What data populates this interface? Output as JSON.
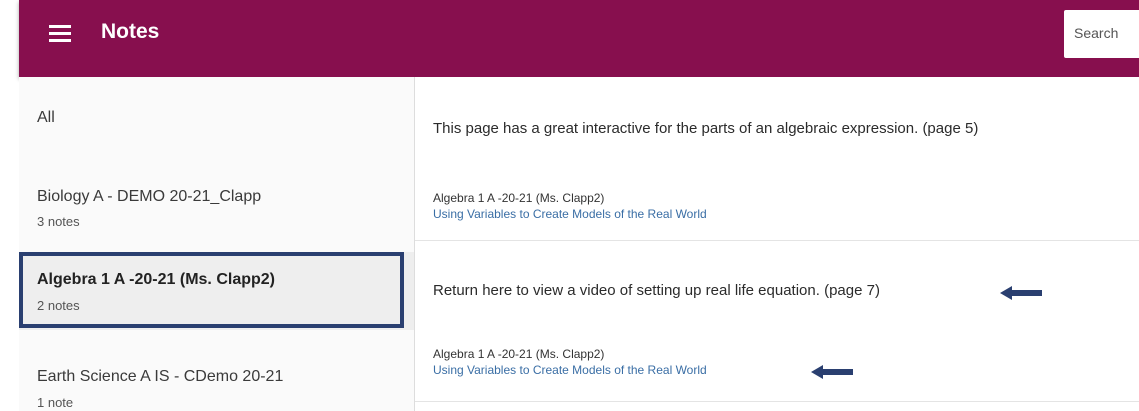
{
  "header": {
    "title": "Notes",
    "search_placeholder": "Search",
    "menu_icon": "hamburger-menu-icon",
    "background_color": "#870f4e"
  },
  "sidebar": {
    "items": [
      {
        "label": "All",
        "count": ""
      },
      {
        "label": "Biology A - DEMO 20-21_Clapp",
        "count": "3 notes"
      },
      {
        "label": "Algebra 1 A -20-21 (Ms. Clapp2)",
        "count": "2 notes",
        "selected": true
      },
      {
        "label": "Earth Science A IS - CDemo 20-21",
        "count": "1 note"
      }
    ],
    "highlight_color": "#2a3f70"
  },
  "notes": [
    {
      "text": "This page has a great interactive for the parts of an algebraic expression. (page 5)",
      "course": "Algebra 1 A -20-21 (Ms. Clapp2)",
      "link": "Using Variables to Create Models of the Real World"
    },
    {
      "text": "Return here to view a video of setting up real life equation. (page 7)",
      "course": "Algebra 1 A -20-21 (Ms. Clapp2)",
      "link": "Using Variables to Create Models of the Real World"
    }
  ],
  "annotation_arrow_color": "#2a3f70"
}
